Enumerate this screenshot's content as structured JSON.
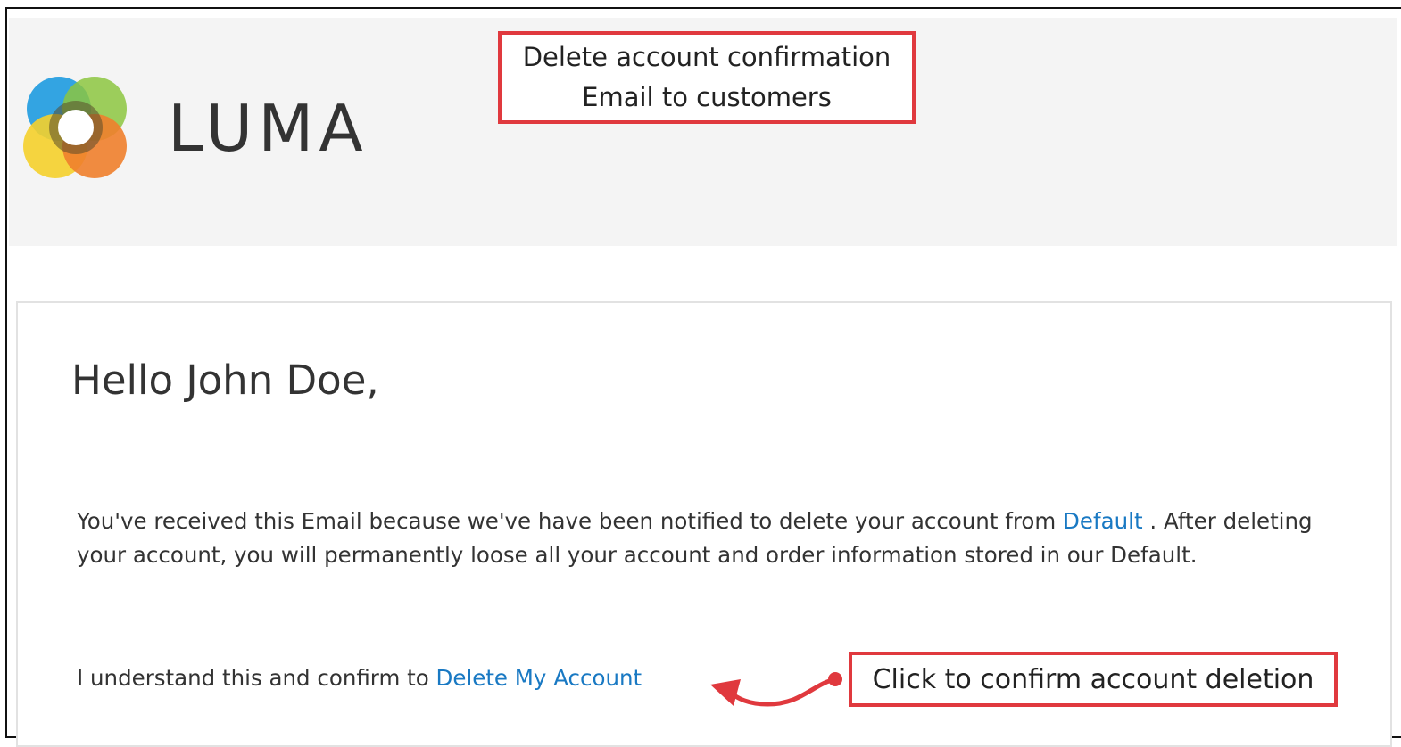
{
  "callouts": {
    "top_line1": "Delete account confirmation",
    "top_line2": "Email to customers",
    "bottom": "Click to confirm account deletion"
  },
  "header": {
    "brand": "LUMA"
  },
  "email": {
    "greeting": "Hello John Doe,",
    "body_part1": "You've received this Email because we've have been notified to delete your account from ",
    "store_link": "Default",
    "body_part2": " . After deleting your account, you will permanently loose all your account and order information stored in our Default.",
    "confirm_text": "I understand this and confirm to ",
    "delete_link": "Delete My Account"
  },
  "colors": {
    "accent_red": "#e0393e",
    "link_blue": "#1979c3",
    "header_bg": "#f4f4f4"
  }
}
